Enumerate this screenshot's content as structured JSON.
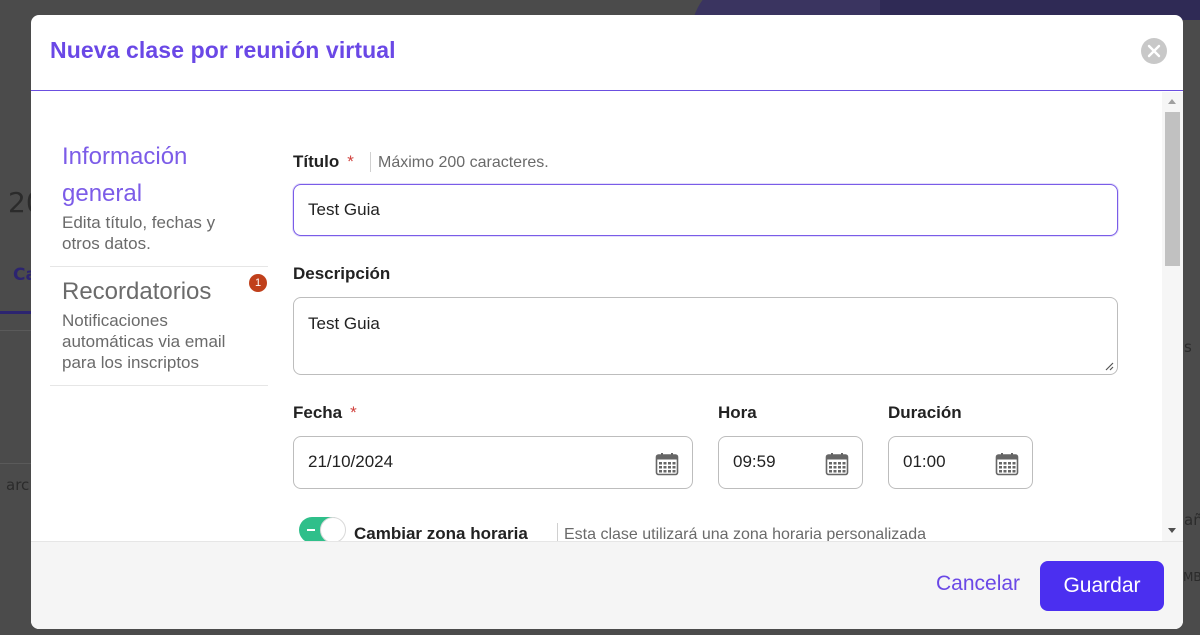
{
  "background": {
    "texts": [
      "20",
      "Ca",
      "arc",
      "s",
      "añ",
      "MB"
    ]
  },
  "modal": {
    "title": "Nueva clase por reunión virtual",
    "steps": [
      {
        "title_line1": "Información",
        "title_line2": "general",
        "description": "Edita título, fechas y otros datos.",
        "active": true
      },
      {
        "title": "Recordatorios",
        "description": "Notificaciones automáticas via email para los inscriptos",
        "badge": "1"
      }
    ],
    "form": {
      "titulo": {
        "label": "Título",
        "required_mark": "*",
        "hint": "Máximo 200 caracteres.",
        "value": "Test Guia"
      },
      "descripcion": {
        "label": "Descripción",
        "value": "Test Guia"
      },
      "fecha": {
        "label": "Fecha",
        "required_mark": "*",
        "value": "21/10/2024"
      },
      "hora": {
        "label": "Hora",
        "value": "09:59"
      },
      "duracion": {
        "label": "Duración",
        "value": "01:00"
      },
      "timezone": {
        "label": "Cambiar zona horaria",
        "hint": "Esta clase utilizará una zona horaria personalizada",
        "enabled": true
      }
    },
    "footer": {
      "cancel_label": "Cancelar",
      "save_label": "Guardar"
    }
  },
  "colors": {
    "accent": "#6a48e6",
    "primary_button": "#4b2ff0",
    "toggle_on": "#2fbf8a",
    "badge": "#c0401b"
  },
  "icons": [
    "close-icon",
    "calendar-icon",
    "resize-grip-icon"
  ]
}
